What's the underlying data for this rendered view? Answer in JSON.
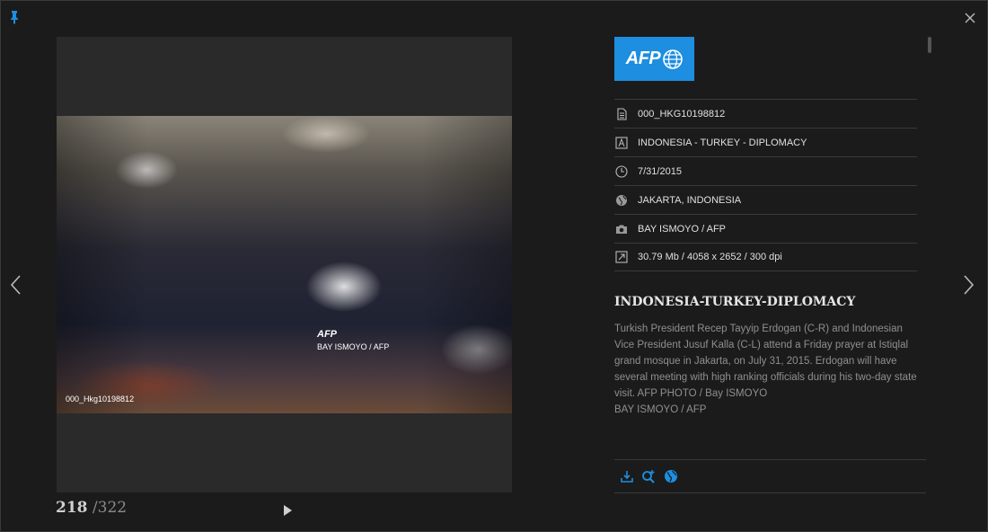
{
  "viewer": {
    "photo_watermark_logo": "AFP",
    "photo_watermark_credit": "BAY ISMOYO / AFP",
    "photo_watermark_id": "000_Hkg10198812",
    "counter_current": "218",
    "counter_total": "/322"
  },
  "agency": {
    "logo_text": "AFP"
  },
  "metadata": [
    {
      "icon": "document-icon",
      "value": "000_HKG10198812"
    },
    {
      "icon": "headline-icon",
      "value": "INDONESIA - TURKEY - DIPLOMACY"
    },
    {
      "icon": "clock-icon",
      "value": "7/31/2015"
    },
    {
      "icon": "globe-icon",
      "value": "JAKARTA, INDONESIA"
    },
    {
      "icon": "camera-icon",
      "value": "BAY ISMOYO / AFP"
    },
    {
      "icon": "resize-icon",
      "value": "30.79 Mb / 4058 x 2652 / 300 dpi"
    }
  ],
  "story": {
    "headline": "INDONESIA-TURKEY-DIPLOMACY",
    "caption": "Turkish President Recep Tayyip Erdogan (C-R) and Indonesian Vice President Jusuf Kalla (C-L) attend a Friday prayer at Istiqlal grand mosque in Jakarta, on July 31, 2015. Erdogan will have several meeting with high ranking officials during his two-day state visit. AFP PHOTO / Bay ISMOYO",
    "credit": "BAY ISMOYO / AFP"
  },
  "actions": [
    "download-icon",
    "zoom-in-icon",
    "globe-icon"
  ],
  "colors": {
    "accent": "#1d8ee0",
    "background": "#1b1b1b",
    "panel": "#2a2a2a"
  }
}
